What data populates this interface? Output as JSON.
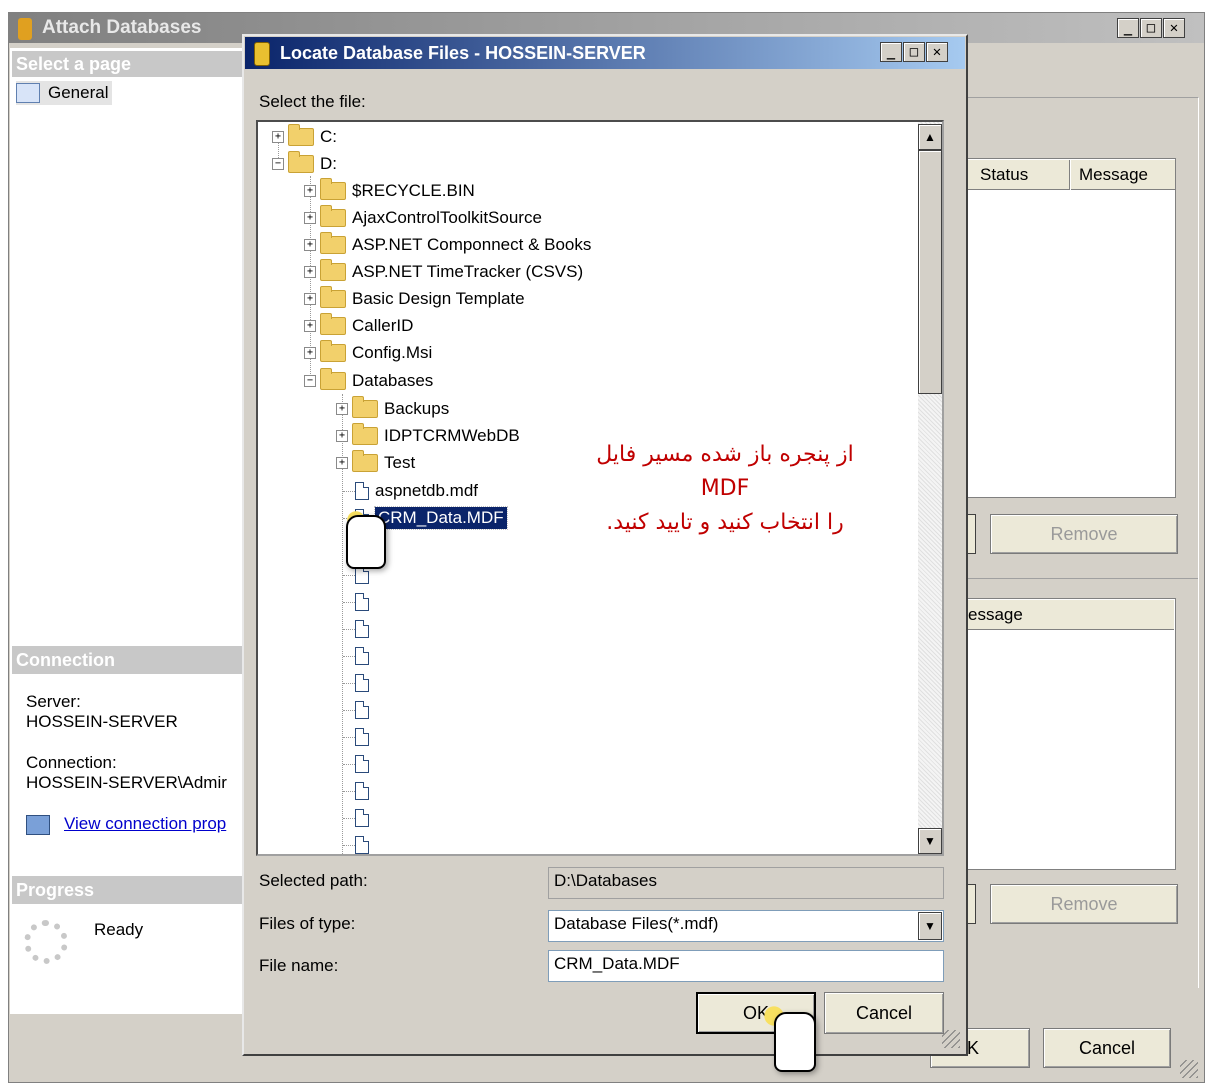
{
  "attach_window": {
    "title": "Attach Databases",
    "select_page_header": "Select a page",
    "pages": [
      {
        "label": "General"
      }
    ],
    "connection_header": "Connection",
    "server_label": "Server:",
    "server_value": "HOSSEIN-SERVER",
    "connection_label": "Connection:",
    "connection_value": "HOSSEIN-SERVER\\Admir",
    "view_connection_link": "View connection prop",
    "progress_header": "Progress",
    "progress_status": "Ready",
    "grid1_columns": [
      "Status",
      "Message"
    ],
    "grid2_column_partial": "essage",
    "remove_button_1": "Remove",
    "remove_button_2": "Remove",
    "ok_partial": "K",
    "cancel_button": "Cancel"
  },
  "locate_dialog": {
    "title": "Locate Database Files - HOSSEIN-SERVER",
    "select_file_label": "Select the file:",
    "tree": {
      "drive_c": "C:",
      "drive_d": "D:",
      "d_folders": [
        "$RECYCLE.BIN",
        "AjaxControlToolkitSource",
        "ASP.NET Componnect & Books",
        "ASP.NET TimeTracker (CSVS)",
        "Basic Design Template",
        "CallerID",
        "Config.Msi"
      ],
      "databases_folder": "Databases",
      "databases_subfolders": [
        "Backups",
        "IDPTCRMWebDB",
        "Test"
      ],
      "files": [
        "aspnetdb.mdf",
        "CRM_Data.MDF"
      ],
      "selected": "CRM_Data.MDF"
    },
    "annotation_lines": [
      "از پنجره باز شده مسیر فایل",
      "MDF",
      "را انتخاب کنید و تایید کنید."
    ],
    "selected_path_label": "Selected path:",
    "selected_path_value": "D:\\Databases",
    "files_of_type_label": "Files of type:",
    "files_of_type_value": "Database Files(*.mdf)",
    "file_name_label": "File name:",
    "file_name_value": "CRM_Data.MDF",
    "ok_button": "OK",
    "cancel_button": "Cancel"
  },
  "colors": {
    "title_active_start": "#0a246a",
    "title_active_end": "#a6caf0",
    "title_inactive": "#808080",
    "annotation": "#c00000",
    "selection": "#0a246a"
  }
}
